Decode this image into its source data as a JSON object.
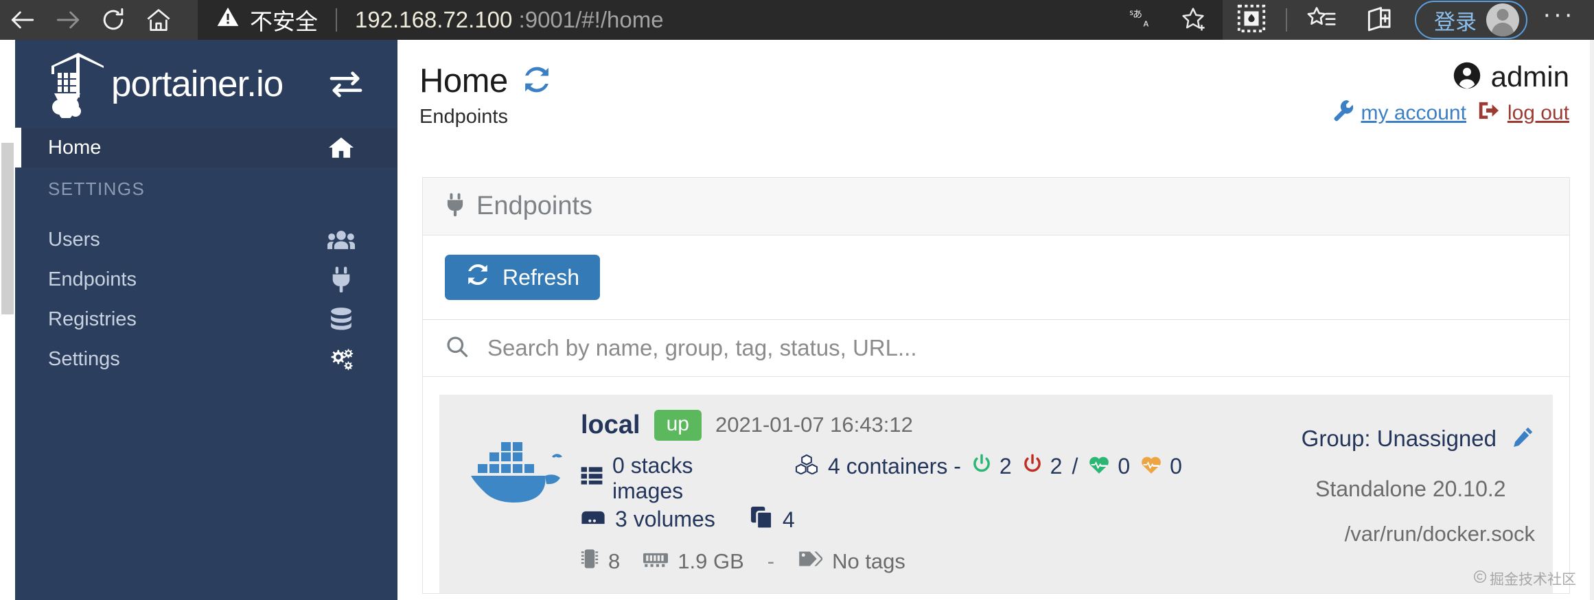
{
  "browser": {
    "back_icon": "back-arrow-icon",
    "forward_icon": "forward-arrow-icon",
    "reload_icon": "reload-icon",
    "home_icon": "home-icon",
    "security_label": "不安全",
    "security_icon": "warning-triangle-icon",
    "url_host": "192.168.72.100",
    "url_rest": ":9001/#!/home",
    "translate_icon": "translate-icon",
    "favorite_icon": "star-outline-icon",
    "collections_icon": "collections-icon",
    "favorites_bar_icon": "favorites-list-icon",
    "split_screen_icon": "split-screen-icon",
    "signin_label": "登录",
    "profile_icon": "profile-avatar-icon",
    "more_label": "···",
    "accent_blue": "#5aa0e0"
  },
  "sidebar": {
    "brand": "portainer.io",
    "brand_logo_icon": "portainer-crane-logo-icon",
    "toggle_icon": "collapse-sidebar-icon",
    "bg_color": "#2c3e5d",
    "items": [
      {
        "label": "Home",
        "icon": "home-icon",
        "active": true
      },
      {
        "label": "SETTINGS",
        "icon": "",
        "section": true
      },
      {
        "label": "Users",
        "icon": "users-group-icon"
      },
      {
        "label": "Endpoints",
        "icon": "plug-icon"
      },
      {
        "label": "Registries",
        "icon": "database-icon"
      },
      {
        "label": "Settings",
        "icon": "gears-icon"
      }
    ]
  },
  "header": {
    "title": "Home",
    "refresh_icon": "sync-refresh-icon",
    "subtitle": "Endpoints",
    "user_name": "admin",
    "user_icon": "user-circle-icon",
    "my_account_label": "my account",
    "my_account_icon": "wrench-icon",
    "log_out_label": "log out",
    "log_out_icon": "sign-out-icon",
    "link_color": "#3b7fc4",
    "logout_color": "#9c3b33"
  },
  "card": {
    "head_label": "Endpoints",
    "head_icon": "plug-icon",
    "refresh_label": "Refresh",
    "refresh_icon": "sync-refresh-icon",
    "refresh_color": "#337ab7",
    "search_icon": "search-icon",
    "search_placeholder": "Search by name, group, tag, status, URL...",
    "search_value": ""
  },
  "endpoint": {
    "logo_icon": "docker-whale-icon",
    "name": "local",
    "status": "up",
    "status_color": "#5cb85c",
    "timestamp": "2021-01-07 16:43:12",
    "stacks_icon": "stacks-list-icon",
    "stacks_label": "0 stacks images",
    "containers_icon": "containers-cubes-icon",
    "containers_label": "4 containers -",
    "running_icon": "power-on-icon",
    "running_count": "2",
    "stopped_icon": "power-off-icon",
    "stopped_count": "2",
    "divider": "/",
    "healthy_icon": "heartbeat-green-icon",
    "healthy_count": "0",
    "unhealthy_icon": "heartbeat-orange-icon",
    "unhealthy_count": "0",
    "volumes_icon": "volumes-drive-icon",
    "volumes_label": "3 volumes",
    "images_icon": "images-clone-icon",
    "images_count": "4",
    "cpu_icon": "cpu-chip-icon",
    "cpu_count": "8",
    "memory_icon": "memory-ram-icon",
    "memory_label": "1.9 GB",
    "meta_separator": "-",
    "tags_icon": "tag-icon",
    "tags_label": "No tags",
    "group_label": "Group: Unassigned",
    "group_edit_icon": "pencil-edit-icon",
    "kind": "Standalone 20.10.2",
    "socket": "/var/run/docker.sock",
    "name_color": "#23355b"
  },
  "watermark": {
    "icon": "copyright-icon",
    "text": "掘金技术社区"
  }
}
